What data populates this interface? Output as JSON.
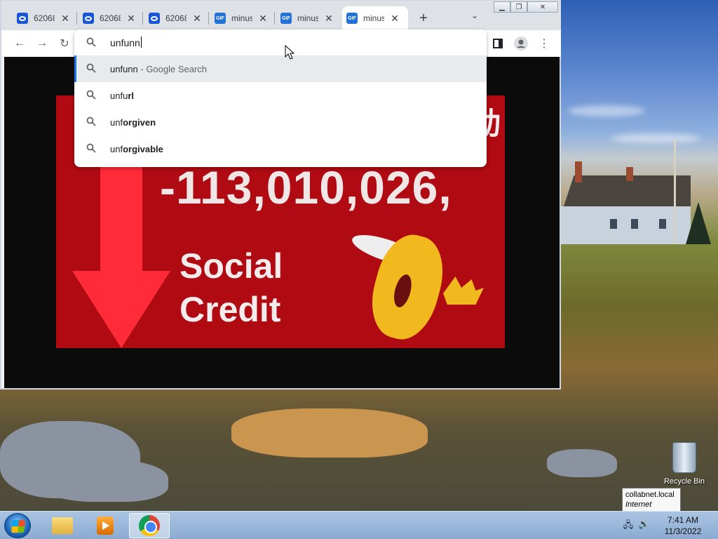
{
  "browser": {
    "tabs": [
      {
        "title": "62068",
        "favicon": "o-logo-icon",
        "active": false
      },
      {
        "title": "62068",
        "favicon": "o-logo-icon",
        "active": false
      },
      {
        "title": "62068",
        "favicon": "o-logo-icon",
        "active": false
      },
      {
        "title": "minus",
        "favicon": "gif-icon",
        "active": false
      },
      {
        "title": "minus",
        "favicon": "gif-icon",
        "active": false
      },
      {
        "title": "minus",
        "favicon": "gif-icon",
        "active": true
      }
    ],
    "gif_label": "GIF",
    "new_tab": "+",
    "tab_menu": "⌄",
    "omnibox": {
      "value": "unfunn",
      "suggestions": [
        {
          "prefix": "unfunn",
          "bold": "",
          "suffix": " - Google Search",
          "selected": true
        },
        {
          "prefix": "unfu",
          "bold": "rl",
          "suffix": "",
          "selected": false
        },
        {
          "prefix": "unf",
          "bold": "orgiven",
          "suffix": "",
          "selected": false
        },
        {
          "prefix": "unf",
          "bold": "orgivable",
          "suffix": "",
          "selected": false
        }
      ]
    },
    "poster": {
      "number": "-113,010,026,",
      "line1": "Social",
      "line2": "Credit",
      "cjk": "动"
    }
  },
  "desktop": {
    "recycle_bin_label": "Recycle Bin",
    "tooltip_line1": "collabnet.local",
    "tooltip_line2": "Internet access"
  },
  "taskbar": {
    "time": "7:41 AM",
    "date": "11/3/2022"
  },
  "colors": {
    "accent": "#1a73e8",
    "poster_red": "#b00a12"
  }
}
